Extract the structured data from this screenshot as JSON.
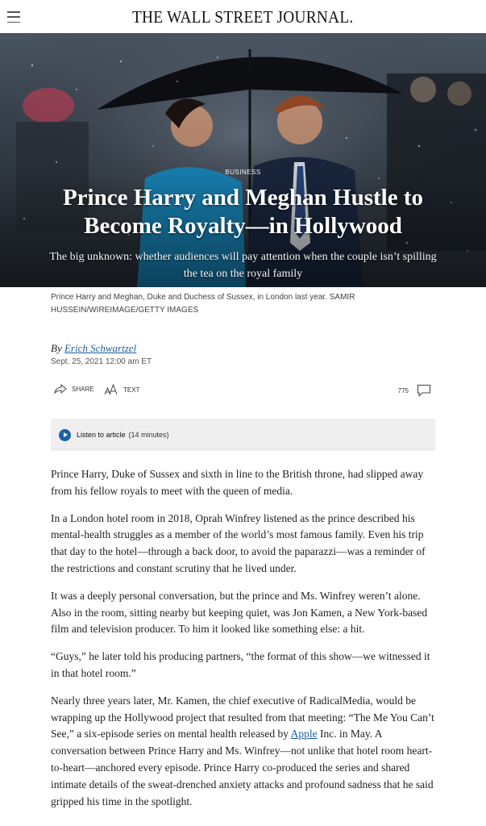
{
  "header": {
    "masthead": "THE WALL STREET JOURNAL."
  },
  "hero": {
    "kicker": "BUSINESS",
    "headline": "Prince Harry and Meghan Hustle to Become Royalty—in Hollywood",
    "dek": "The big unknown: whether audiences will pay attention when the couple isn’t spilling the tea on the royal family"
  },
  "caption": "Prince Harry and Meghan, Duke and Duchess of Sussex, in London last year. SAMIR HUSSEIN/WIREIMAGE/GETTY IMAGES",
  "byline": {
    "prefix": "By",
    "author": "Erich Schwartzel",
    "date": "Sept. 25, 2021 12:00 am ET"
  },
  "toolbar": {
    "share_label": "SHARE",
    "text_label": "TEXT",
    "comment_count": "775"
  },
  "listen": {
    "label": "Listen to article",
    "duration": "(14 minutes)"
  },
  "article": {
    "p1": "Prince Harry, Duke of Sussex and sixth in line to the British throne, had slipped away from his fellow royals to meet with the queen of media.",
    "p2": "In a London hotel room in 2018, Oprah Winfrey listened as the prince described his mental-health struggles as a member of the world’s most famous family. Even his trip that day to the hotel—through a back door, to avoid the paparazzi—was a reminder of the restrictions and constant scrutiny that he lived under.",
    "p3": "It was a deeply personal conversation, but the prince and Ms. Winfrey weren’t alone. Also in the room, sitting nearby but keeping quiet, was Jon Kamen, a New York-based film and television producer. To him it looked like something else: a hit.",
    "p4": "“Guys,” he later told his producing partners, “the format of this show—we witnessed it in that hotel room.”",
    "p5_before": "Nearly three years later, Mr. Kamen, the chief executive of RadicalMedia, would be wrapping up the Hollywood project that resulted from that meeting: “The Me You Can’t See,” a six-episode series on mental health released by ",
    "p5_link": "Apple",
    "p5_after": " Inc. in May. A conversation between Prince Harry and Ms. Winfrey—not unlike that hotel room heart-to-heart—anchored every episode. Prince Harry co-produced the series and shared intimate details of the sweat-drenched anxiety attacks and profound sadness that he said gripped his time in the spotlight."
  },
  "colors": {
    "link": "#1a5fa3",
    "play_button": "#1d5fa8",
    "listen_bg": "#efefef"
  },
  "icons": [
    "menu-icon",
    "share-icon",
    "text-size-icon",
    "comment-icon",
    "play-icon"
  ]
}
